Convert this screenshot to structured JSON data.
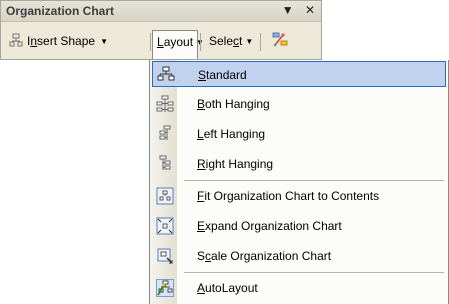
{
  "toolbar": {
    "title": "Organization Chart",
    "dropdown_glyph": "▼",
    "close_glyph": "✕",
    "insert_shape": {
      "prefix": "I",
      "underlined": "n",
      "rest": "sert Shape",
      "arrow": "▼"
    },
    "layout": {
      "prefix": "",
      "underlined": "L",
      "rest": "ayout",
      "arrow": "▼"
    },
    "select": {
      "prefix": "Sele",
      "underlined": "c",
      "rest": "t",
      "arrow": "▼"
    }
  },
  "menu": {
    "items": [
      {
        "icon": "standard-layout-icon",
        "underlined": "S",
        "rest": "tandard",
        "highlighted": true
      },
      {
        "icon": "both-hanging-icon",
        "underlined": "B",
        "rest": "oth Hanging"
      },
      {
        "icon": "left-hanging-icon",
        "underlined": "L",
        "rest": "eft Hanging"
      },
      {
        "icon": "right-hanging-icon",
        "underlined": "R",
        "rest": "ight Hanging"
      },
      {
        "icon": "fit-to-contents-icon",
        "underlined": "F",
        "rest": "it Organization Chart to Contents"
      },
      {
        "icon": "expand-chart-icon",
        "underlined": "E",
        "rest": "xpand Organization Chart"
      },
      {
        "icon": "scale-chart-icon",
        "pre": "S",
        "underlined": "c",
        "rest": "ale Organization Chart"
      },
      {
        "icon": "autolayout-icon",
        "underlined": "A",
        "rest": "utoLayout"
      }
    ]
  },
  "colors": {
    "highlight_fill": "#c1d2ee",
    "highlight_border": "#316ac5",
    "toolbar_bg": "#ece9d8"
  }
}
